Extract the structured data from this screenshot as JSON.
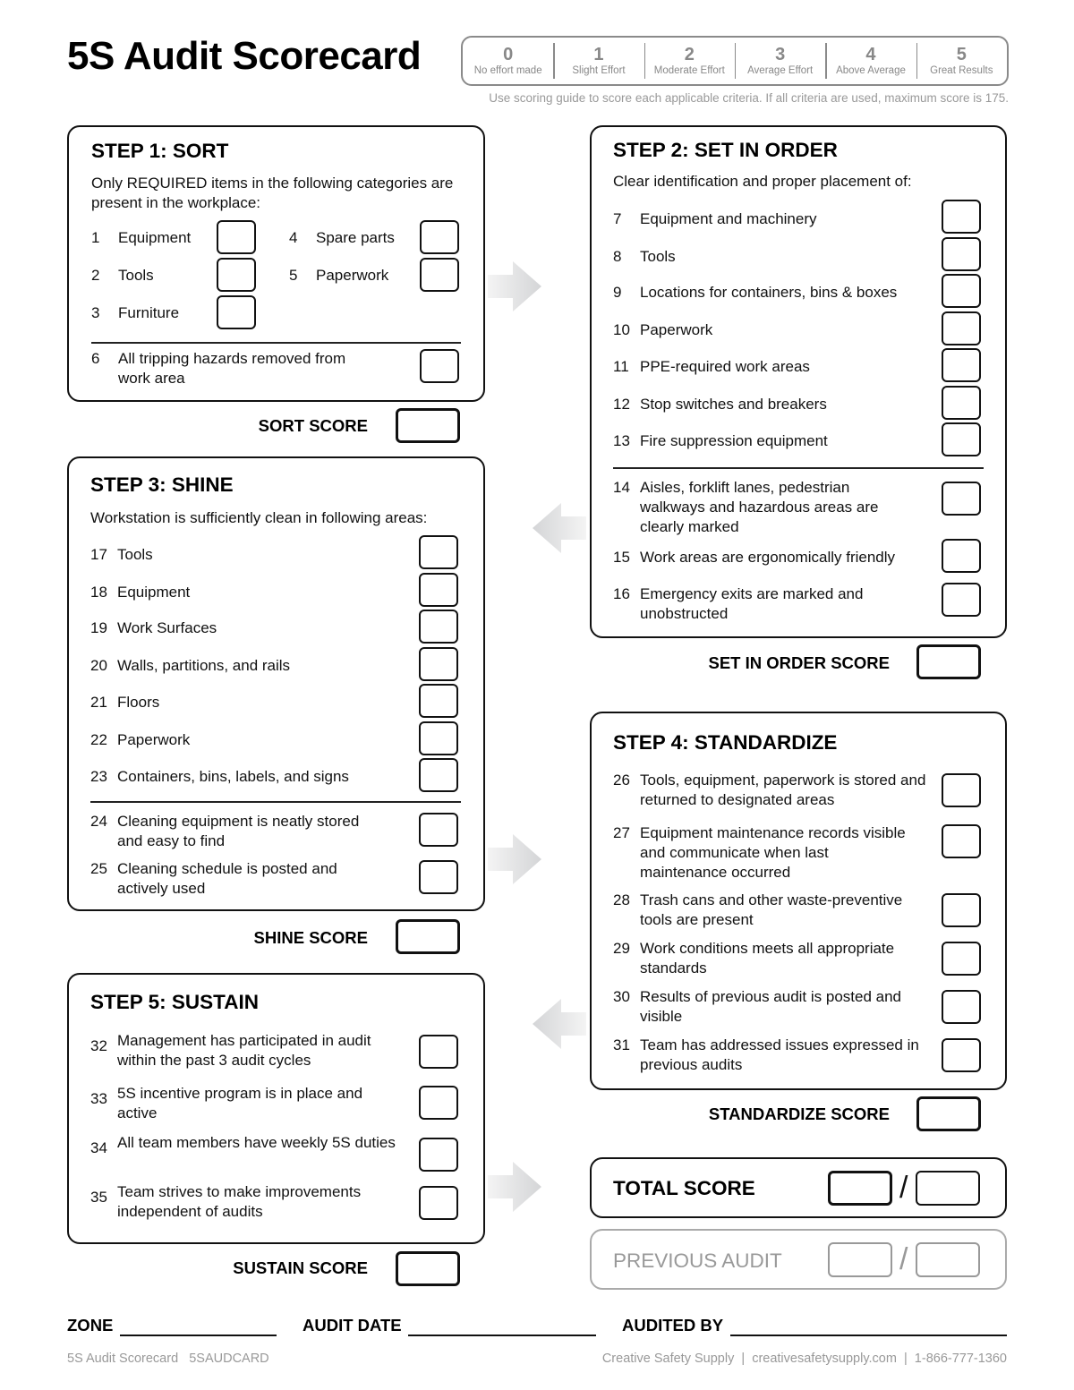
{
  "title": "5S Audit Scorecard",
  "scoring_guide": {
    "levels": [
      {
        "value": "0",
        "label": "No effort made"
      },
      {
        "value": "1",
        "label": "Slight Effort"
      },
      {
        "value": "2",
        "label": "Moderate Effort"
      },
      {
        "value": "3",
        "label": "Average Effort"
      },
      {
        "value": "4",
        "label": "Above Average"
      },
      {
        "value": "5",
        "label": "Great Results"
      }
    ],
    "note": "Use scoring guide to score each applicable criteria. If all criteria are used, maximum score is 175."
  },
  "sort": {
    "title": "STEP 1: SORT",
    "description": "Only REQUIRED items in the following categories are present in the workplace:",
    "items": [
      {
        "num": "1",
        "text": "Equipment"
      },
      {
        "num": "2",
        "text": "Tools"
      },
      {
        "num": "3",
        "text": "Furniture"
      },
      {
        "num": "4",
        "text": "Spare parts"
      },
      {
        "num": "5",
        "text": "Paperwork"
      },
      {
        "num": "6",
        "text": "All tripping hazards removed from work area"
      }
    ],
    "score_label": "SORT SCORE"
  },
  "set_in_order": {
    "title": "STEP 2: SET IN ORDER",
    "description": "Clear identification and proper placement of:",
    "items": [
      {
        "num": "7",
        "text": "Equipment and machinery"
      },
      {
        "num": "8",
        "text": "Tools"
      },
      {
        "num": "9",
        "text": "Locations for containers, bins & boxes"
      },
      {
        "num": "10",
        "text": "Paperwork"
      },
      {
        "num": "11",
        "text": "PPE-required work areas"
      },
      {
        "num": "12",
        "text": "Stop switches and breakers"
      },
      {
        "num": "13",
        "text": "Fire suppression equipment"
      },
      {
        "num": "14",
        "text": "Aisles, forklift lanes, pedestrian walkways and hazardous areas are clearly marked"
      },
      {
        "num": "15",
        "text": "Work areas are ergonomically friendly"
      },
      {
        "num": "16",
        "text": "Emergency exits are marked and unobstructed"
      }
    ],
    "score_label": "SET IN ORDER SCORE"
  },
  "shine": {
    "title": "STEP 3: SHINE",
    "description": "Workstation is sufficiently clean in following areas:",
    "items": [
      {
        "num": "17",
        "text": "Tools"
      },
      {
        "num": "18",
        "text": "Equipment"
      },
      {
        "num": "19",
        "text": "Work Surfaces"
      },
      {
        "num": "20",
        "text": "Walls, partitions, and rails"
      },
      {
        "num": "21",
        "text": "Floors"
      },
      {
        "num": "22",
        "text": "Paperwork"
      },
      {
        "num": "23",
        "text": "Containers, bins, labels, and signs"
      },
      {
        "num": "24",
        "text": "Cleaning equipment is neatly stored and easy to find"
      },
      {
        "num": "25",
        "text": "Cleaning schedule is posted and actively used"
      }
    ],
    "score_label": "SHINE SCORE"
  },
  "standardize": {
    "title": "STEP 4: STANDARDIZE",
    "items": [
      {
        "num": "26",
        "text": "Tools, equipment, paperwork is stored and returned to designated areas"
      },
      {
        "num": "27",
        "text": "Equipment maintenance records visible and communicate when last maintenance occurred"
      },
      {
        "num": "28",
        "text": "Trash cans and other waste-preventive tools are present"
      },
      {
        "num": "29",
        "text": "Work conditions meets all appropriate standards"
      },
      {
        "num": "30",
        "text": "Results of previous audit is posted and visible"
      },
      {
        "num": "31",
        "text": "Team has addressed issues expressed in previous audits"
      }
    ],
    "score_label": "STANDARDIZE SCORE"
  },
  "sustain": {
    "title": "STEP 5: SUSTAIN",
    "items": [
      {
        "num": "32",
        "text": "Management has participated in audit within the past 3 audit cycles"
      },
      {
        "num": "33",
        "text": "5S incentive program is in place and active"
      },
      {
        "num": "34",
        "text": "All team members have weekly 5S duties"
      },
      {
        "num": "35",
        "text": "Team strives to make improvements independent of audits"
      }
    ],
    "score_label": "SUSTAIN SCORE"
  },
  "total": {
    "label": "TOTAL SCORE",
    "separator": "/"
  },
  "previous": {
    "label": "PREVIOUS AUDIT",
    "separator": "/"
  },
  "fields": {
    "zone": "ZONE",
    "audit_date": "AUDIT DATE",
    "audited_by": "AUDITED BY"
  },
  "footer": {
    "left": "5S Audit Scorecard   5SAUDCARD",
    "right": "Creative Safety Supply  |  creativesafetysupply.com  |  1-866-777-1360"
  },
  "colors": {
    "ink": "#111111",
    "muted": "#999999",
    "arrow": "#d9d9d9"
  }
}
